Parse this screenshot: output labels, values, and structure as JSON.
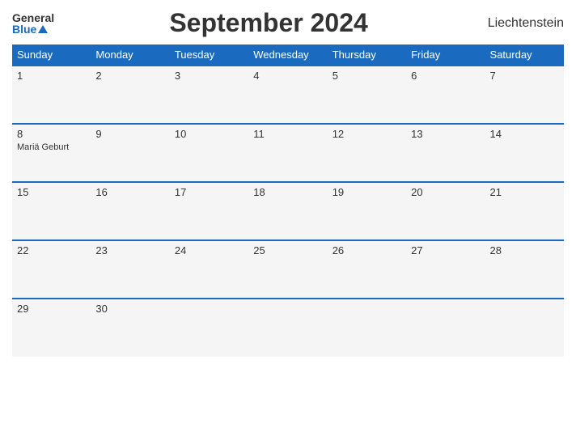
{
  "header": {
    "logo_general": "General",
    "logo_blue": "Blue",
    "title": "September 2024",
    "country": "Liechtenstein"
  },
  "weekdays": [
    "Sunday",
    "Monday",
    "Tuesday",
    "Wednesday",
    "Thursday",
    "Friday",
    "Saturday"
  ],
  "weeks": [
    [
      {
        "day": "1",
        "event": ""
      },
      {
        "day": "2",
        "event": ""
      },
      {
        "day": "3",
        "event": ""
      },
      {
        "day": "4",
        "event": ""
      },
      {
        "day": "5",
        "event": ""
      },
      {
        "day": "6",
        "event": ""
      },
      {
        "day": "7",
        "event": ""
      }
    ],
    [
      {
        "day": "8",
        "event": "Mariä Geburt"
      },
      {
        "day": "9",
        "event": ""
      },
      {
        "day": "10",
        "event": ""
      },
      {
        "day": "11",
        "event": ""
      },
      {
        "day": "12",
        "event": ""
      },
      {
        "day": "13",
        "event": ""
      },
      {
        "day": "14",
        "event": ""
      }
    ],
    [
      {
        "day": "15",
        "event": ""
      },
      {
        "day": "16",
        "event": ""
      },
      {
        "day": "17",
        "event": ""
      },
      {
        "day": "18",
        "event": ""
      },
      {
        "day": "19",
        "event": ""
      },
      {
        "day": "20",
        "event": ""
      },
      {
        "day": "21",
        "event": ""
      }
    ],
    [
      {
        "day": "22",
        "event": ""
      },
      {
        "day": "23",
        "event": ""
      },
      {
        "day": "24",
        "event": ""
      },
      {
        "day": "25",
        "event": ""
      },
      {
        "day": "26",
        "event": ""
      },
      {
        "day": "27",
        "event": ""
      },
      {
        "day": "28",
        "event": ""
      }
    ],
    [
      {
        "day": "29",
        "event": ""
      },
      {
        "day": "30",
        "event": ""
      },
      {
        "day": "",
        "event": ""
      },
      {
        "day": "",
        "event": ""
      },
      {
        "day": "",
        "event": ""
      },
      {
        "day": "",
        "event": ""
      },
      {
        "day": "",
        "event": ""
      }
    ]
  ]
}
